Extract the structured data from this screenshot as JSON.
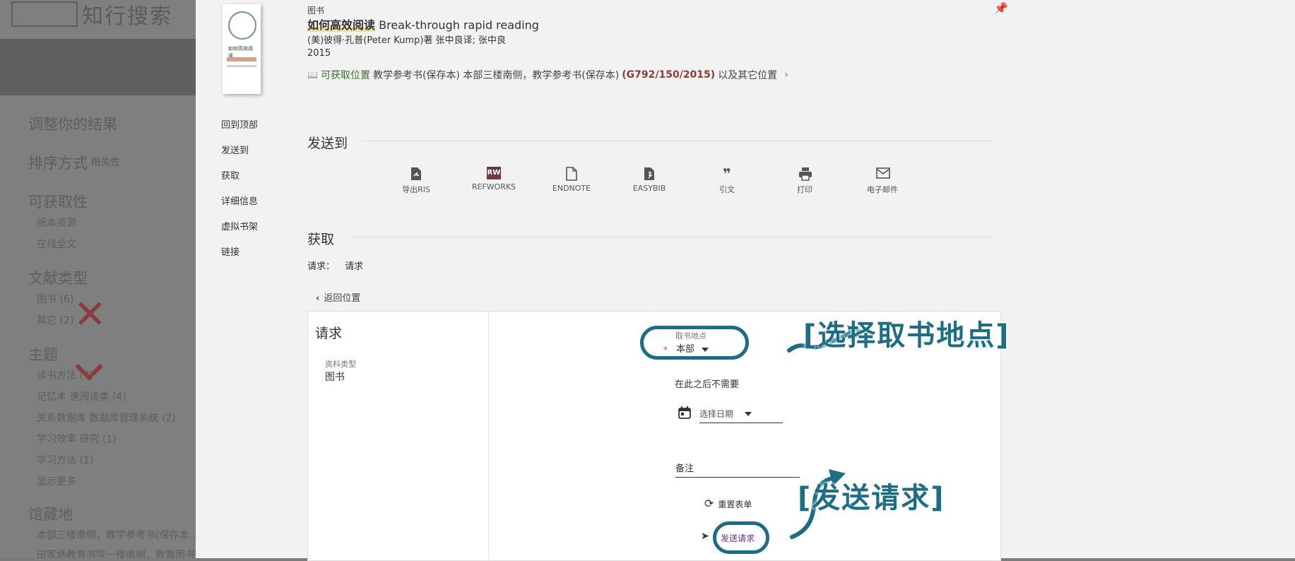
{
  "background": {
    "logo_text": "知行搜索",
    "heading_adjust": "调整你的结果",
    "sort_label": "排序方式",
    "sort_value": "相关性",
    "availability": "可获取性",
    "avail_items": [
      "纸本资源",
      "在线全文"
    ],
    "doc_type": "文献类型",
    "doc_items": [
      "图书 (6)",
      "其它 (2)"
    ],
    "subject": "主题",
    "subject_items": [
      "读书方法 (7)",
      "记忆术 速阅读类 (4)",
      "关系数据库 数据库管理系统 (2)",
      "学习效率 研究 (1)",
      "学习方法 (1)",
      "显示更多"
    ],
    "library": "馆藏地",
    "library_items": [
      "本部三楼南侧，教学参考书(保存本...",
      "田家炳教育书院一楼南侧，教育图书..."
    ]
  },
  "record": {
    "type_label": "图书",
    "title_zh": "如何高效阅读",
    "title_en": "Break-through rapid reading",
    "authors": "(美)彼得·孔普(Peter Kump)著 张中良译; 张中良",
    "year": "2015",
    "avail_label": "可获取位置",
    "avail_text": "教学参考书(保存本)  本部三楼南侧，教学参考书(保存本)",
    "call_number": "(G792/150/2015)",
    "avail_more": "以及其它位置",
    "cover_title": "如何高效阅读"
  },
  "side_nav": [
    "回到顶部",
    "发送到",
    "获取",
    "详细信息",
    "虚拟书架",
    "链接"
  ],
  "send_to": {
    "heading": "发送到",
    "actions": [
      {
        "label": "导出RIS",
        "icon": "ris-file-icon"
      },
      {
        "label": "REFWORKS",
        "icon": "refworks-icon",
        "badge": "RW"
      },
      {
        "label": "ENDNOTE",
        "icon": "document-icon"
      },
      {
        "label": "EASYBIB",
        "icon": "easybib-icon"
      },
      {
        "label": "引文",
        "icon": "quote-icon"
      },
      {
        "label": "打印",
        "icon": "printer-icon"
      },
      {
        "label": "电子邮件",
        "icon": "email-icon"
      }
    ]
  },
  "get_it": {
    "heading": "获取",
    "request_label": "请求：",
    "request_value": "请求",
    "back_label": "返回位置"
  },
  "form": {
    "title": "请求",
    "material_type_label": "资料类型",
    "material_type_value": "图书",
    "pickup_label": "取书地点",
    "pickup_value": "本部",
    "not_needed_label": "在此之后不需要",
    "date_placeholder": "选择日期",
    "notes_label": "备注",
    "reset_label": "重置表单",
    "submit_label": "发送请求"
  },
  "annotations": {
    "pickup_callout": "[选择取书地点]",
    "send_callout": "[发送请求]"
  },
  "colors": {
    "annotation": "#1d6d84",
    "accent_red": "#8a3d3d",
    "available_green": "#3b6e2f",
    "submit_purple": "#6a2c91"
  }
}
